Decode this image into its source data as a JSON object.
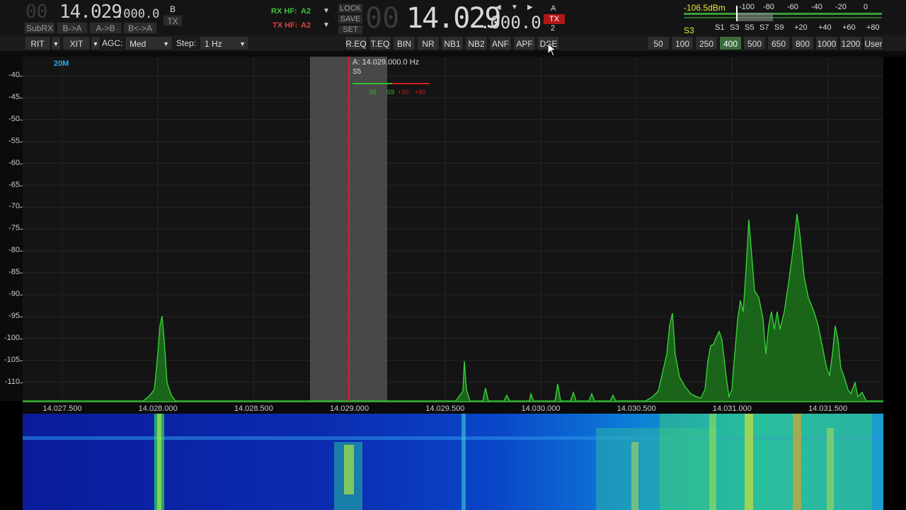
{
  "vfo_b": {
    "dim": "00",
    "freq_main": "14.029",
    "freq_sub": ".000.0"
  },
  "buttons_left": [
    "SubRX",
    "B->A",
    "A->B",
    "B<->A"
  ],
  "vfo_b_label": "B",
  "vfo_b_tx": "TX",
  "rx_hf": {
    "label": "RX HF:",
    "value": "A2"
  },
  "tx_hf": {
    "label": "TX HF:",
    "value": "A2"
  },
  "lock_buttons": [
    "LOCK",
    "SAVE",
    "SET"
  ],
  "vfo_a": {
    "dim": "00",
    "freq_main": "14.029",
    "freq_sub": ".000.0"
  },
  "vfo_a_label": "A",
  "vfo_a_tx": "TX",
  "vfo_a_num": "2",
  "meter": {
    "dbm": "-106.5dBm",
    "s_reading": "S3",
    "top_scale": [
      "-100",
      "-80",
      "-60",
      "-40",
      "-20",
      "0"
    ],
    "bottom_scale": [
      "S1",
      "S3",
      "S5",
      "S7",
      "S9",
      "+20",
      "+40",
      "+60",
      "+80"
    ]
  },
  "bar2": {
    "rit": "RIT",
    "xit": "XIT",
    "agc_label": "AGC:",
    "agc_value": "Med",
    "step_label": "Step:",
    "step_value": "1 Hz",
    "dsp_buttons": [
      "R.EQ",
      "T.EQ",
      "BIN",
      "NR",
      "NB1",
      "NB2",
      "ANF",
      "APF",
      "DSE"
    ],
    "filters": [
      "50",
      "100",
      "250",
      "400",
      "500",
      "650",
      "800",
      "1000",
      "1200",
      "User"
    ],
    "active_filter": "400"
  },
  "pan": {
    "band": "20M",
    "vfo_readout": "A: 14.029.000.0 Hz",
    "smeter_label": "S5",
    "mini_scale": [
      "S5",
      "S9",
      "+20",
      "+40"
    ],
    "y_labels": [
      "-40",
      "-45",
      "-50",
      "-55",
      "-60",
      "-65",
      "-70",
      "-75",
      "-80",
      "-85",
      "-90",
      "-95",
      "-100",
      "-105",
      "-110"
    ],
    "x_labels": [
      "14.027.500",
      "14.028.000",
      "14.028.500",
      "14.029.000",
      "14.029.500",
      "14.030.000",
      "14.030.500",
      "14.031.000",
      "14.031.500"
    ],
    "colors": {
      "trace": "#38d838",
      "fill": "#1c6e1c",
      "vfo_line": "#e02020",
      "passband": "#5a5a5a"
    }
  }
}
